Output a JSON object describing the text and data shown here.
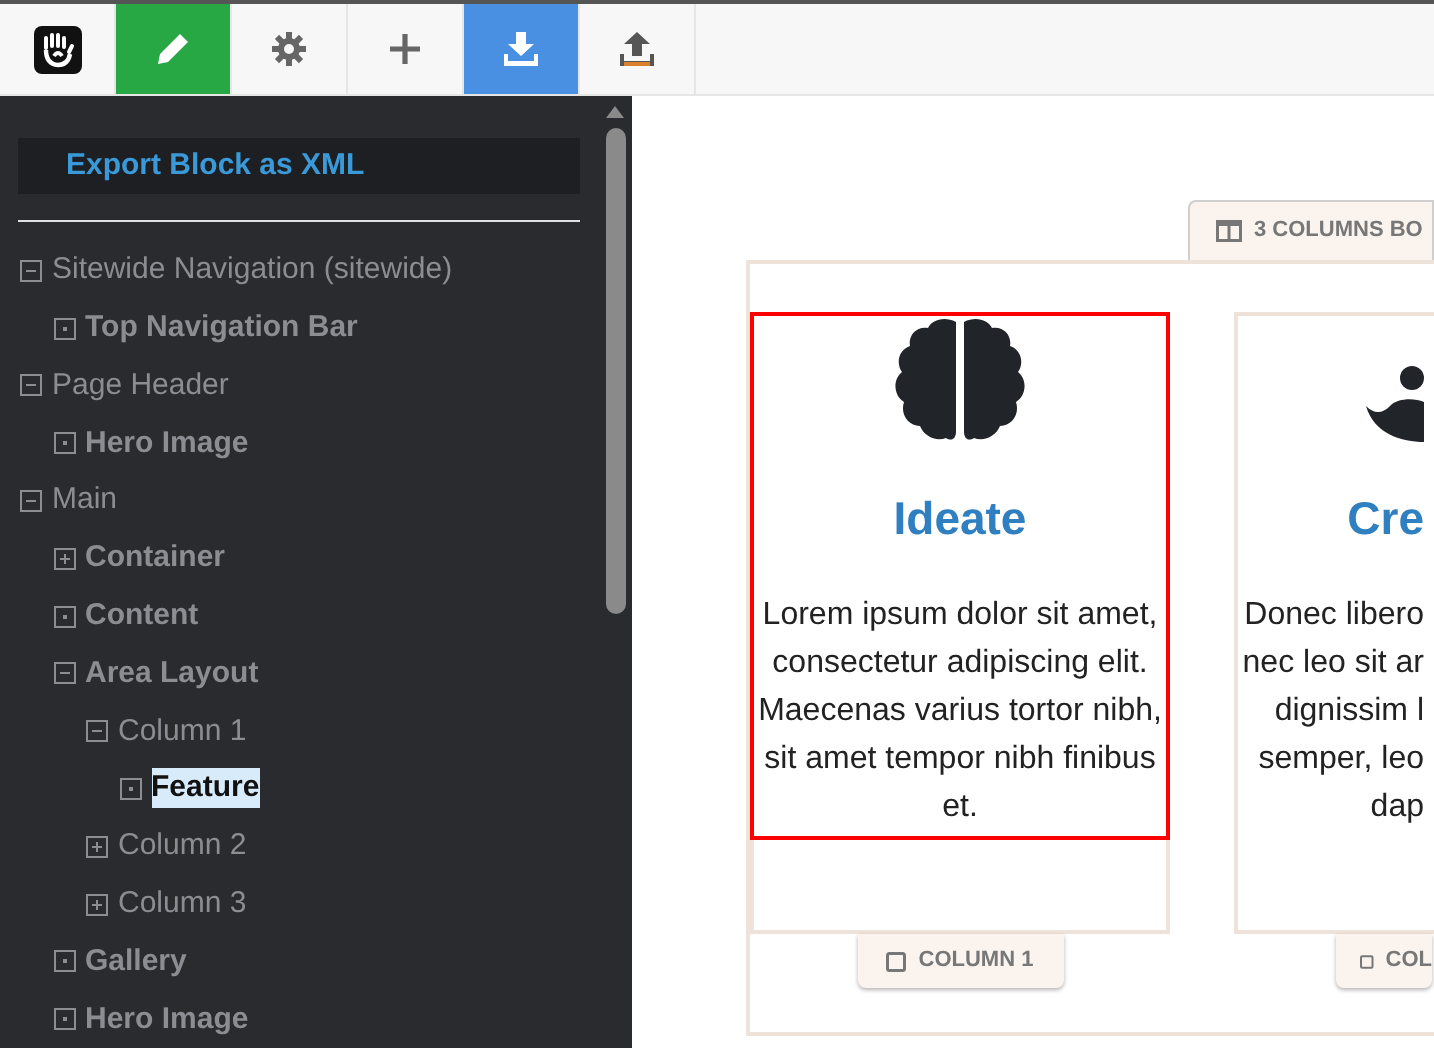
{
  "toolbar": {
    "buttons": [
      {
        "kind": "logo",
        "selected": false
      },
      {
        "kind": "edit",
        "selected": true,
        "color": "#28a745"
      },
      {
        "kind": "settings",
        "selected": false
      },
      {
        "kind": "add",
        "selected": false
      },
      {
        "kind": "export",
        "selected": true,
        "color": "#4a90e2"
      },
      {
        "kind": "import",
        "selected": false
      }
    ]
  },
  "sidebar": {
    "export_menu": {
      "item": "Export Block as XML"
    },
    "tree": [
      {
        "label": "Sitewide Navigation (sitewide)",
        "kind": "area",
        "expanded": true,
        "selected": false,
        "children": [
          {
            "label": "Top Navigation Bar",
            "kind": "block",
            "selected": false
          }
        ]
      },
      {
        "label": "Page Header",
        "kind": "area",
        "expanded": true,
        "selected": false,
        "children": [
          {
            "label": "Hero Image",
            "kind": "block",
            "selected": false
          }
        ]
      },
      {
        "label": "Main",
        "kind": "area",
        "expanded": true,
        "selected": false,
        "children": [
          {
            "label": "Container",
            "kind": "block",
            "expanded": false,
            "selected": false
          },
          {
            "label": "Content",
            "kind": "block",
            "selected": false
          },
          {
            "label": "Area Layout",
            "kind": "block",
            "expanded": true,
            "selected": false,
            "children": [
              {
                "label": "Column 1",
                "kind": "area",
                "expanded": true,
                "selected": false,
                "children": [
                  {
                    "label": "Feature",
                    "kind": "block",
                    "selected": true
                  }
                ]
              },
              {
                "label": "Column 2",
                "kind": "area",
                "expanded": false,
                "selected": false
              },
              {
                "label": "Column 3",
                "kind": "area",
                "expanded": false,
                "selected": false
              }
            ]
          },
          {
            "label": "Gallery",
            "kind": "block",
            "selected": false
          },
          {
            "label": "Hero Image",
            "kind": "block",
            "selected": false
          }
        ]
      }
    ]
  },
  "canvas": {
    "block_tab": "3 COLUMNS BO",
    "columns": [
      {
        "title": "Ideate",
        "lines": [
          "Lorem ipsum dolor sit amet,",
          "consectetur adipiscing elit.",
          "Maecenas varius tortor nibh,",
          "sit amet tempor nibh finibus",
          "et."
        ],
        "label": "COLUMN 1",
        "selected": true
      },
      {
        "title": "Cre",
        "lines": [
          "Donec libero",
          "nec leo sit ar",
          "dignissim l",
          "semper, leo",
          "dap"
        ],
        "label": "COL",
        "selected": false
      }
    ]
  }
}
